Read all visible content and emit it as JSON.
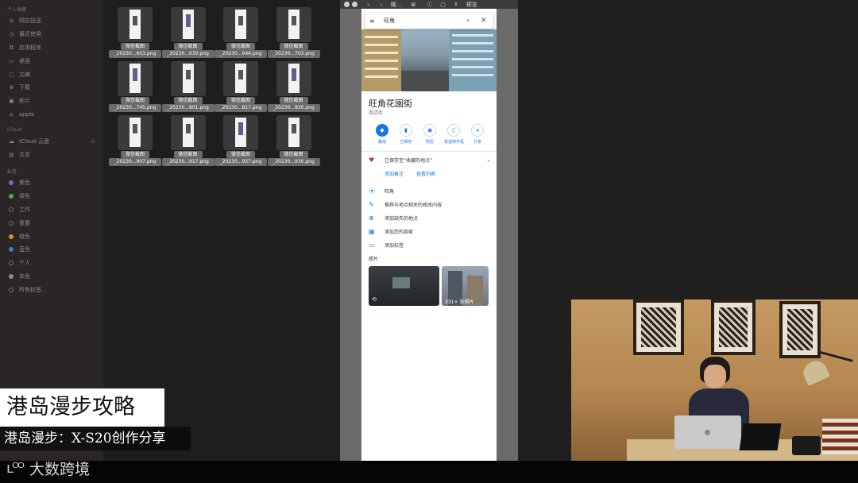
{
  "sidebar": {
    "favorites_heading": "个人收藏",
    "favorites": [
      {
        "icon": "airdrop-icon",
        "glyph": "◎",
        "label": "隔空投送"
      },
      {
        "icon": "recents-icon",
        "glyph": "◷",
        "label": "最近使用"
      },
      {
        "icon": "applications-icon",
        "glyph": "⌘",
        "label": "应用程序"
      },
      {
        "icon": "desktop-icon",
        "glyph": "▭",
        "label": "桌面"
      },
      {
        "icon": "documents-icon",
        "glyph": "▢",
        "label": "文稿"
      },
      {
        "icon": "downloads-icon",
        "glyph": "⊕",
        "label": "下载"
      },
      {
        "icon": "movies-icon",
        "glyph": "▣",
        "label": "影片"
      },
      {
        "icon": "home-icon",
        "glyph": "⌂",
        "label": "apple"
      }
    ],
    "icloud_heading": "iCloud",
    "icloud": [
      {
        "icon": "icloud-drive-icon",
        "glyph": "☁",
        "label": "iCloud 云盘",
        "warning": "⚠"
      },
      {
        "icon": "shared-icon",
        "glyph": "▤",
        "label": "共享"
      }
    ],
    "tags_heading": "标签",
    "tags": [
      {
        "label": "紫色",
        "color": "#8e5fb8"
      },
      {
        "label": "绿色",
        "color": "#4caf50"
      },
      {
        "label": "工作",
        "color": ""
      },
      {
        "label": "重要",
        "color": ""
      },
      {
        "label": "橙色",
        "color": "#e28a2b"
      },
      {
        "label": "蓝色",
        "color": "#3e7bd6"
      },
      {
        "label": "个人",
        "color": ""
      },
      {
        "label": "灰色",
        "color": "#8a8a8a"
      },
      {
        "label": "所有标签...",
        "color": ""
      }
    ]
  },
  "files": [
    {
      "kind": "微信截图",
      "name": "_20230...603.png"
    },
    {
      "kind": "微信截图",
      "name": "_20230...630.png"
    },
    {
      "kind": "微信截图",
      "name": "_20230...644.png"
    },
    {
      "kind": "微信截图",
      "name": "_20230...703.png"
    },
    {
      "kind": "微信截图",
      "name": "_20230...745.png"
    },
    {
      "kind": "微信截图",
      "name": "_20230...801.png"
    },
    {
      "kind": "微信截图",
      "name": "_20230...817.png"
    },
    {
      "kind": "微信截图",
      "name": "_20230...830.png"
    },
    {
      "kind": "微信截图",
      "name": "_20230...907.png"
    },
    {
      "kind": "微信截图",
      "name": "_20230...917.png"
    },
    {
      "kind": "微信截图",
      "name": "_20230...927.png"
    },
    {
      "kind": "微信截图",
      "name": "_20230...930.png"
    }
  ],
  "viewer": {
    "title": "微...",
    "preview_label": "预览"
  },
  "maps": {
    "search_query": "旺角",
    "place_title": "旺角花園街",
    "place_subtitle": "商店街",
    "actions": [
      {
        "label": "路线",
        "icon": "directions-icon",
        "glyph": "◆"
      },
      {
        "label": "已保存",
        "icon": "bookmark-icon",
        "glyph": "▮"
      },
      {
        "label": "附近",
        "icon": "nearby-icon",
        "glyph": "◉"
      },
      {
        "label": "发送到手机",
        "icon": "phone-icon",
        "glyph": "▯"
      },
      {
        "label": "分享",
        "icon": "share-icon",
        "glyph": "⋖"
      }
    ],
    "saved_row": "已保存至“收藏的地点”",
    "link_note": "添加备注",
    "link_list": "查看列表",
    "rows": [
      {
        "icon": "pin-icon",
        "glyph": "⦿",
        "label": "旺角"
      },
      {
        "icon": "edit-icon",
        "glyph": "✎",
        "label": "推荐与地点相关的修改内容"
      },
      {
        "icon": "add-place-icon",
        "glyph": "⊕",
        "label": "添加缺失的地点"
      },
      {
        "icon": "business-icon",
        "glyph": "▦",
        "label": "添加您的商家"
      },
      {
        "icon": "label-icon",
        "glyph": "▭",
        "label": "添加标签"
      }
    ],
    "photos_label": "照片",
    "photo_count": "331+ 张照片"
  },
  "captions": {
    "title": "港岛漫步攻略",
    "subtitle": "港岛漫步：X-S20创作分享"
  },
  "logo": {
    "mark": "ʟᴼᴼ",
    "text": "大数跨境"
  }
}
